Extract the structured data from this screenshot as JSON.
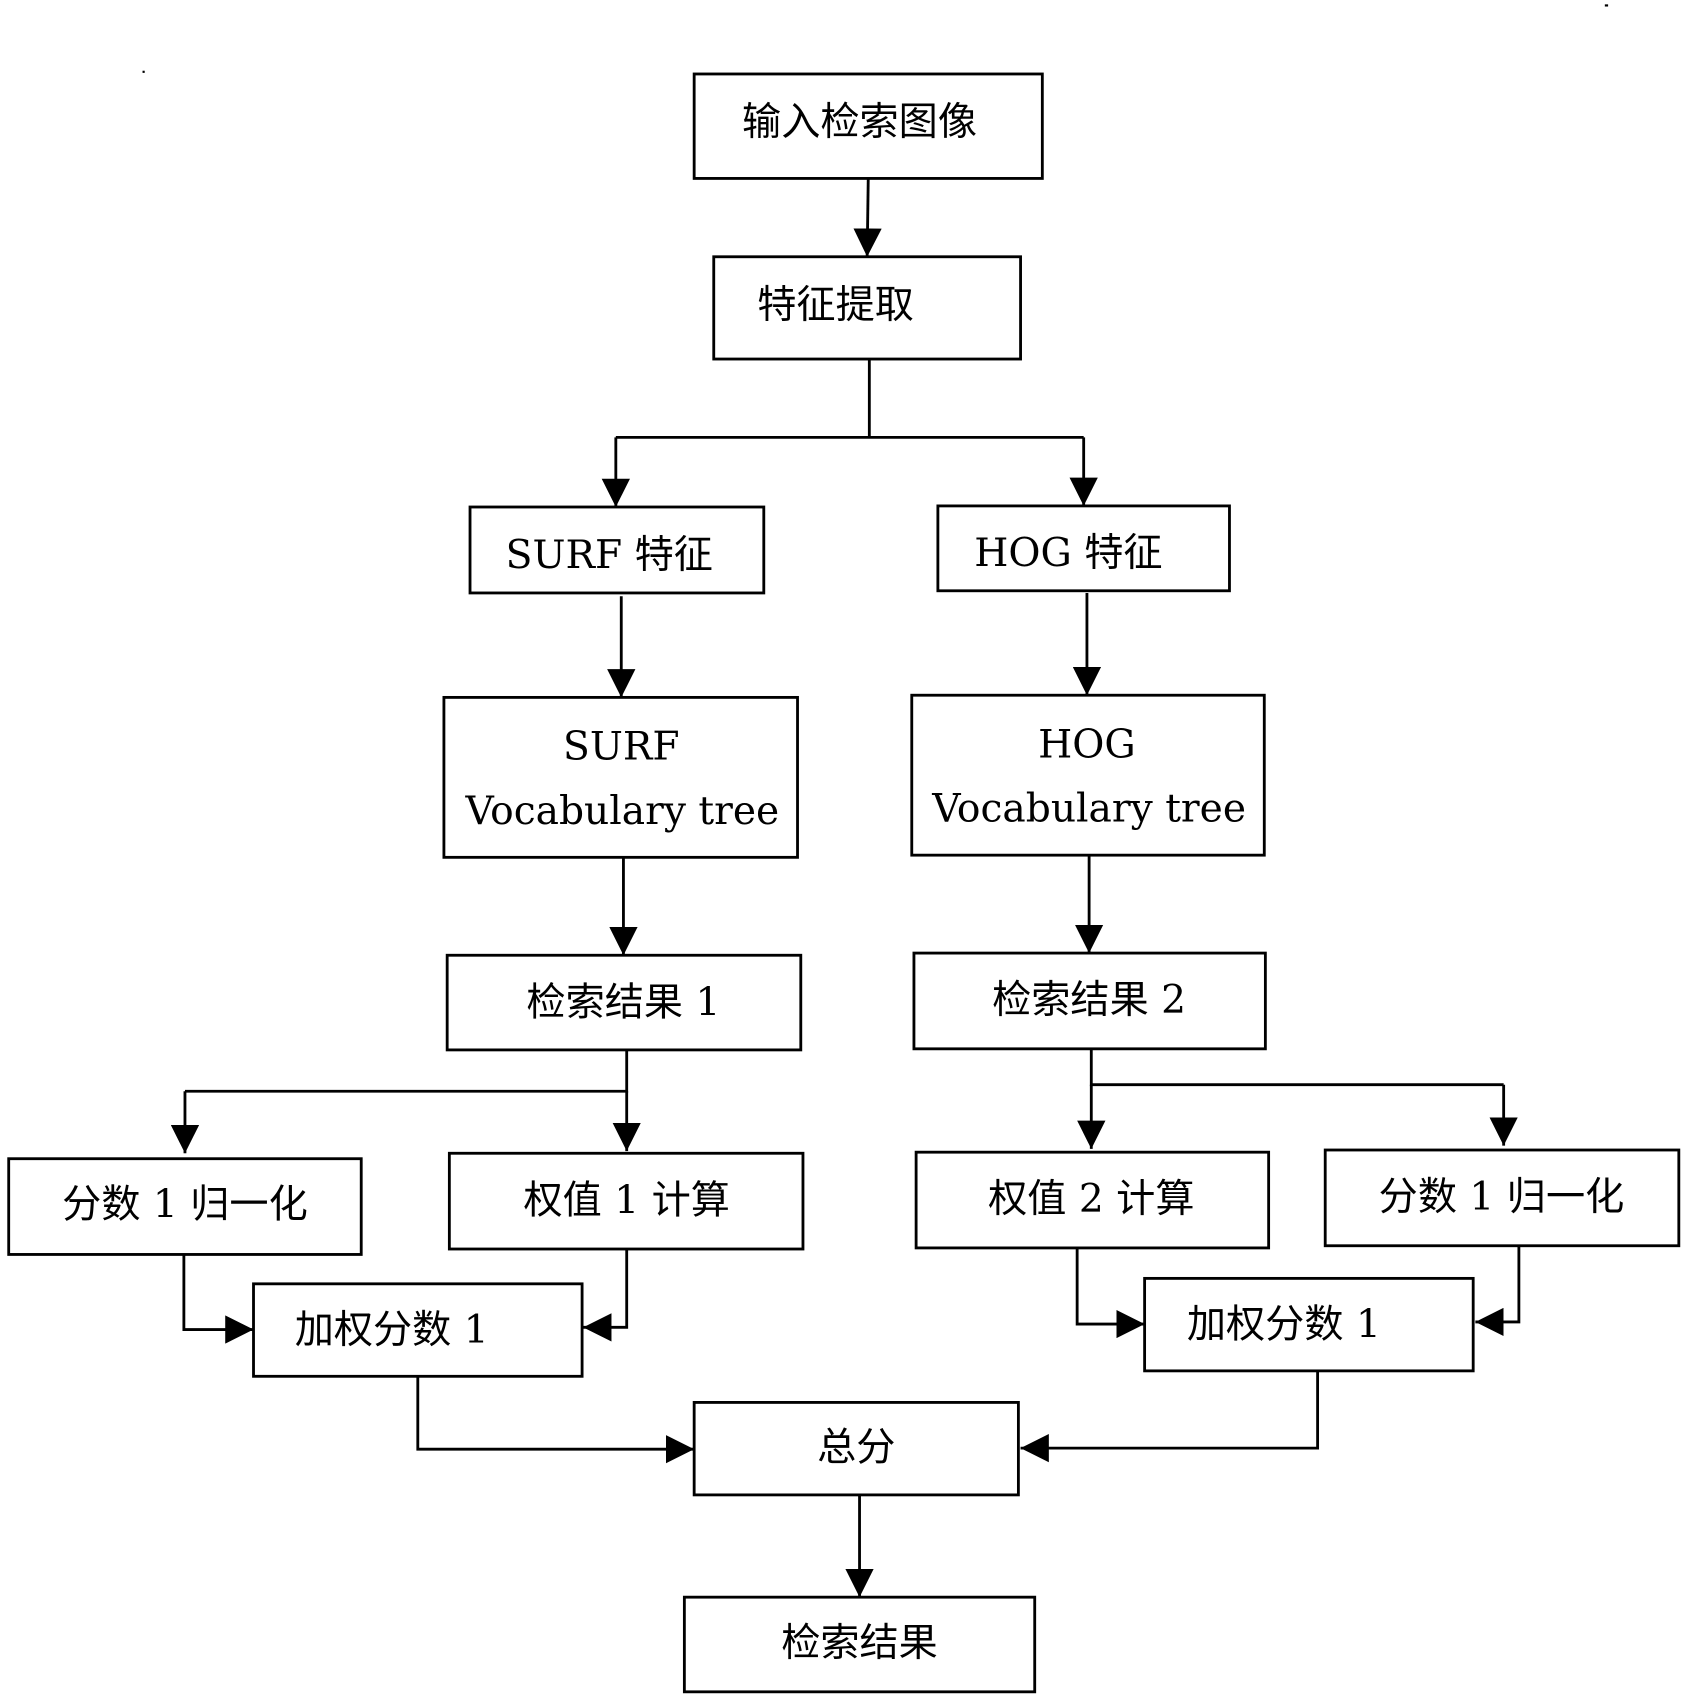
{
  "diagram": {
    "nodes": {
      "input": {
        "label": "输入检索图像"
      },
      "extract": {
        "label": "特征提取"
      },
      "surf_feat": {
        "label": "SURF 特征"
      },
      "hog_feat": {
        "label": "HOG 特征"
      },
      "surf_tree": {
        "line1": "SURF",
        "line2": "Vocabulary tree"
      },
      "hog_tree": {
        "line1": "HOG",
        "line2": "Vocabulary tree"
      },
      "result1": {
        "label": "检索结果 1"
      },
      "result2": {
        "label": "检索结果 2"
      },
      "norm1_left": {
        "label": "分数 1 归一化"
      },
      "weight1": {
        "label": "权值 1 计算"
      },
      "weight2": {
        "label": "权值 2 计算"
      },
      "norm1_right": {
        "label": "分数 1 归一化"
      },
      "wscore_left": {
        "label": "加权分数 1"
      },
      "wscore_right": {
        "label": "加权分数 1"
      },
      "total": {
        "label": "总分"
      },
      "final": {
        "label": "检索结果"
      }
    },
    "edges": [
      {
        "from": "input",
        "to": "extract"
      },
      {
        "from": "extract",
        "to": "surf_feat"
      },
      {
        "from": "extract",
        "to": "hog_feat"
      },
      {
        "from": "surf_feat",
        "to": "surf_tree"
      },
      {
        "from": "hog_feat",
        "to": "hog_tree"
      },
      {
        "from": "surf_tree",
        "to": "result1"
      },
      {
        "from": "hog_tree",
        "to": "result2"
      },
      {
        "from": "result1",
        "to": "norm1_left"
      },
      {
        "from": "result1",
        "to": "weight1"
      },
      {
        "from": "result2",
        "to": "weight2"
      },
      {
        "from": "result2",
        "to": "norm1_right"
      },
      {
        "from": "norm1_left",
        "to": "wscore_left"
      },
      {
        "from": "weight1",
        "to": "wscore_left"
      },
      {
        "from": "weight2",
        "to": "wscore_right"
      },
      {
        "from": "norm1_right",
        "to": "wscore_right"
      },
      {
        "from": "wscore_left",
        "to": "total"
      },
      {
        "from": "wscore_right",
        "to": "total"
      },
      {
        "from": "total",
        "to": "final"
      }
    ]
  }
}
